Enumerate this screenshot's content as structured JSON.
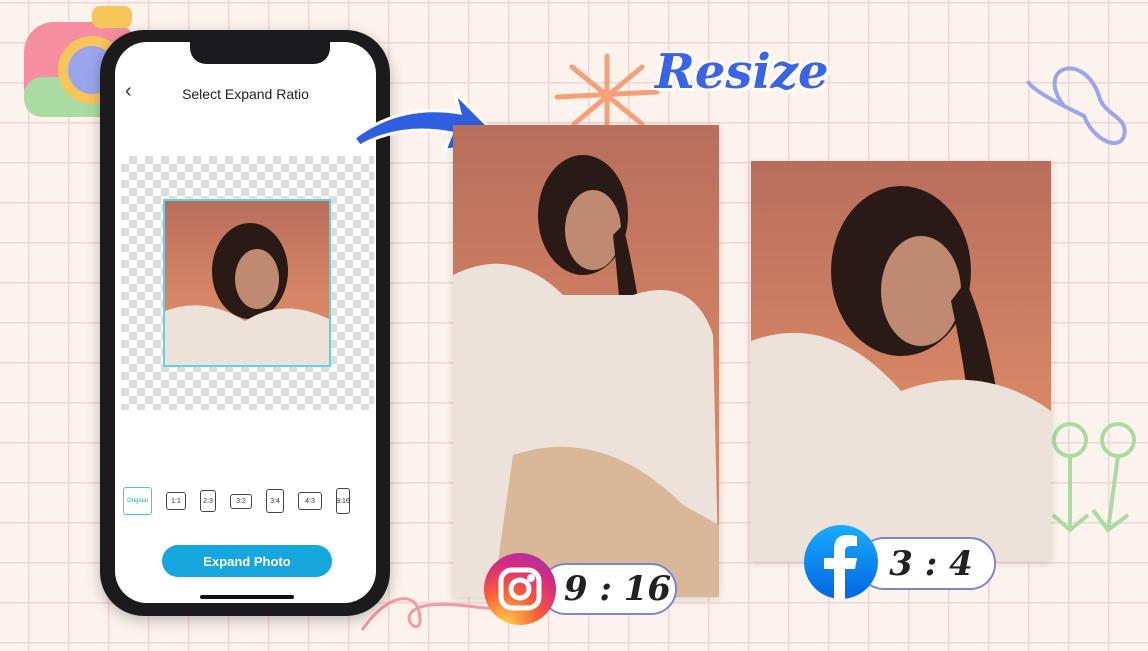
{
  "phone": {
    "title": "Select Expand Ratio",
    "back_icon": "chevron-left-icon",
    "ratios": [
      {
        "label": "Original",
        "selected": true
      },
      {
        "label": "1:1"
      },
      {
        "label": "2:3"
      },
      {
        "label": "3:2"
      },
      {
        "label": "3:4"
      },
      {
        "label": "4:3"
      },
      {
        "label": "9:16"
      }
    ],
    "expand_button": "Expand Photo",
    "accent": "#14a6dc"
  },
  "headline": "Resize",
  "badges": [
    {
      "icon": "instagram-icon",
      "ratio": "9 : 16"
    },
    {
      "icon": "facebook-icon",
      "ratio": "3 : 4"
    }
  ],
  "colors": {
    "headline": "#3a63e6",
    "grid": "#f3d3d3",
    "background": "#fcf3ec"
  }
}
